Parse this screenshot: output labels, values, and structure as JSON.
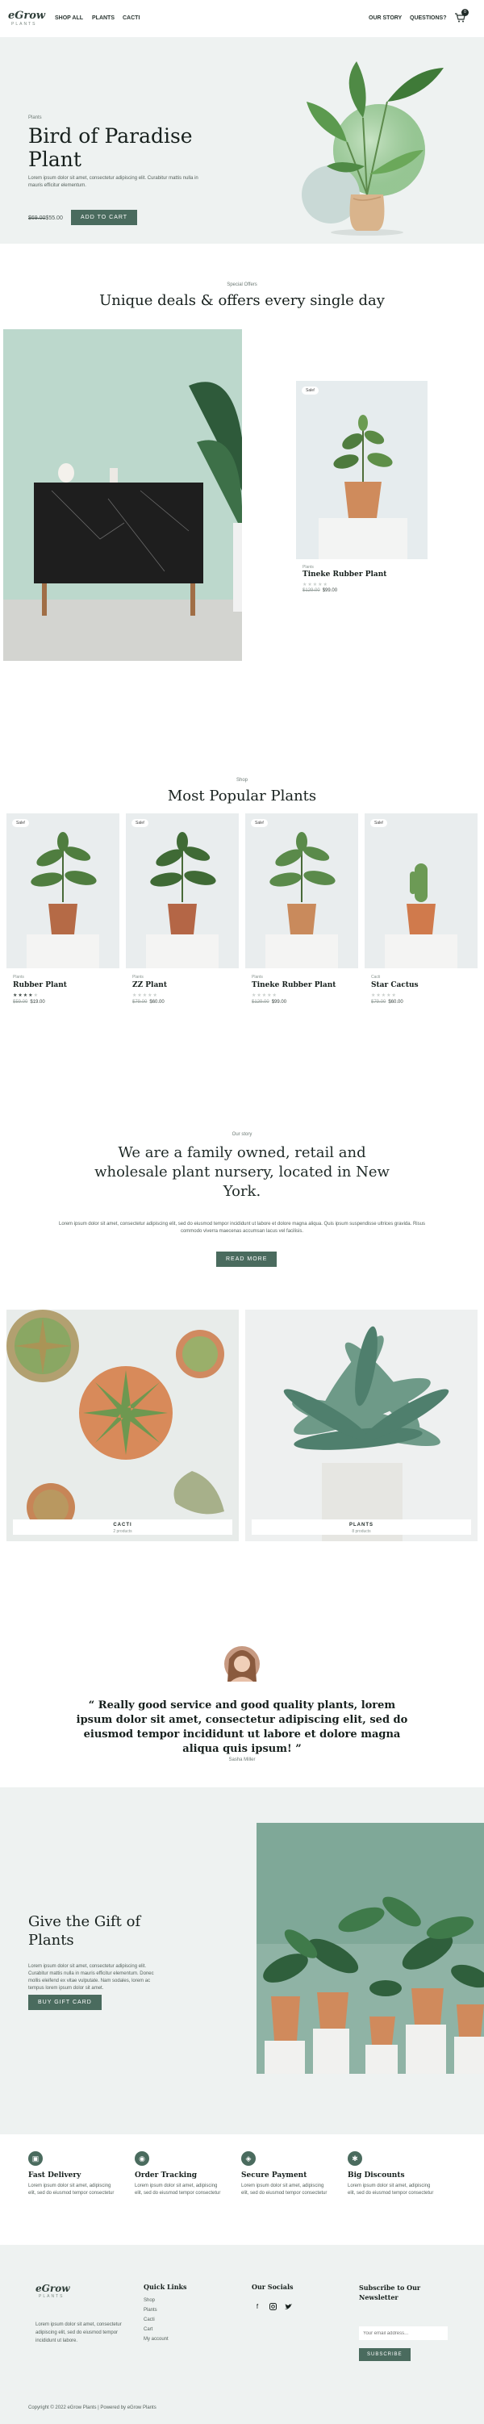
{
  "header": {
    "logo": "eGrow",
    "logo_sub": "PLANTS",
    "nav_left": [
      "SHOP ALL",
      "PLANTS",
      "CACTI"
    ],
    "nav_right": [
      "OUR STORY",
      "QUESTIONS?"
    ],
    "cart_count": "0"
  },
  "hero": {
    "kicker": "Plants",
    "title": "Bird of Paradise Plant",
    "description": "Lorem ipsum dolor sit amet, consectetur adipiscing elit. Curabitur mattis nulla in mauris efficitur elementum.",
    "old_price": "$69.00",
    "price": "$55.00",
    "cta": "ADD TO CART"
  },
  "deals": {
    "kicker": "Special Offers",
    "title": "Unique deals & offers every single day",
    "product": {
      "badge": "Sale!",
      "category": "Plants",
      "name": "Tineke Rubber Plant",
      "old_price": "$129.00",
      "price": "$99.00"
    }
  },
  "popular": {
    "kicker": "Shop",
    "title": "Most Popular Plants",
    "products": [
      {
        "badge": "Sale!",
        "category": "Plants",
        "name": "Rubber Plant",
        "old_price": "$59.00",
        "price": "$19.00",
        "rating": 4
      },
      {
        "badge": "Sale!",
        "category": "Plants",
        "name": "ZZ Plant",
        "old_price": "$79.00",
        "price": "$60.00",
        "rating": 0
      },
      {
        "badge": "Sale!",
        "category": "Plants",
        "name": "Tineke Rubber Plant",
        "old_price": "$129.00",
        "price": "$99.00",
        "rating": 0
      },
      {
        "badge": "Sale!",
        "category": "Cacti",
        "name": "Star Cactus",
        "old_price": "$79.00",
        "price": "$60.00",
        "rating": 0
      }
    ]
  },
  "about": {
    "kicker": "Our story",
    "title": "We are a family owned, retail and wholesale plant nursery, located in New York.",
    "description": "Lorem ipsum dolor sit amet, consectetur adipiscing elit, sed do eiusmod tempor incididunt ut labore et dolore magna aliqua. Quis ipsum suspendisse ultrices gravida. Risus commodo viverra maecenas accumsan lacus vel facilisis.",
    "cta": "READ MORE"
  },
  "categories": [
    {
      "name": "CACTI",
      "count": "2 products"
    },
    {
      "name": "PLANTS",
      "count": "8 products"
    }
  ],
  "testimonial": {
    "quote": "“ Really good service and good quality plants, lorem ipsum dolor sit amet, consectetur adipiscing elit, sed do eiusmod tempor incididunt ut labore et dolore magna aliqua quis ipsum! ”",
    "author": "Sasha Miller"
  },
  "gift": {
    "title": "Give the Gift of Plants",
    "description": "Lorem ipsum dolor sit amet, consectetur adipiscing elit. Curabitur mattis nulla in mauris efficitur elementum. Donec mollis eleifend ex vitae vulputate. Nam sodales, lorem ac tempus lorem ipsum dolor sit amet.",
    "cta": "BUY GIFT CARD"
  },
  "features": [
    {
      "icon": "box-icon",
      "title": "Fast Delivery",
      "desc": "Lorem ipsum dolor sit amet, adipiscing elit, sed do eiusmod tempor consectetur"
    },
    {
      "icon": "location-icon",
      "title": "Order Tracking",
      "desc": "Lorem ipsum dolor sit amet, adipiscing elit, sed do eiusmod tempor consectetur"
    },
    {
      "icon": "lock-icon",
      "title": "Secure Payment",
      "desc": "Lorem ipsum dolor sit amet, adipiscing elit, sed do eiusmod tempor consectetur"
    },
    {
      "icon": "tag-icon",
      "title": "Big Discounts",
      "desc": "Lorem ipsum dolor sit amet, adipiscing elit, sed do eiusmod tempor consectetur"
    }
  ],
  "footer": {
    "logo": "eGrow",
    "logo_sub": "PLANTS",
    "about": "Lorem ipsum dolor sit amet, consectetur adipiscing elit, sed do eiusmod tempor incididunt ut labore.",
    "quick_links_title": "Quick Links",
    "quick_links": [
      "Shop",
      "Plants",
      "Cacti",
      "Cart",
      "My account"
    ],
    "socials_title": "Our Socials",
    "socials": [
      "facebook-icon",
      "instagram-icon",
      "twitter-icon"
    ],
    "newsletter_title": "Subscribe to Our Newsletter",
    "email_placeholder": "Your email address...",
    "subscribe": "SUBSCRIBE",
    "copyright": "Copyright © 2022 eGrow Plants | Powered by eGrow Plants"
  },
  "colors": {
    "accent": "#4a6b5e",
    "light_bg": "#eef2f1",
    "dark_text": "#17201d"
  }
}
